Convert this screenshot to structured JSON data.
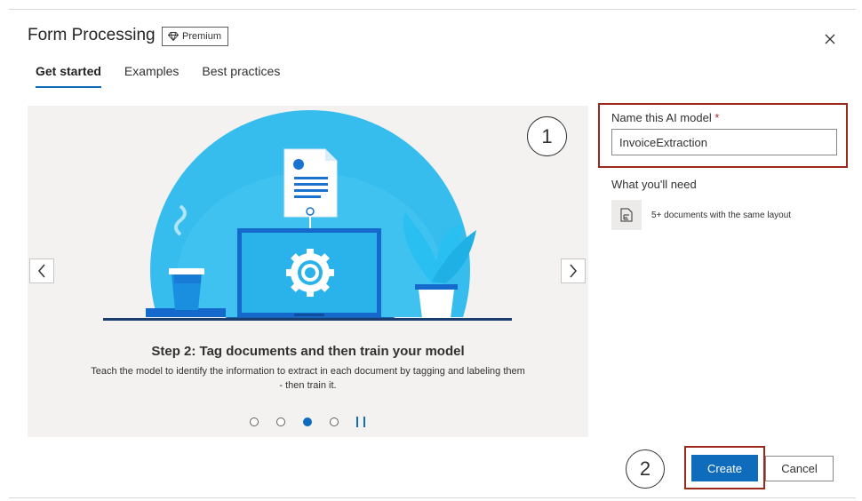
{
  "dialog": {
    "title": "Form Processing",
    "premium_badge": "Premium",
    "close_icon": "close-icon"
  },
  "tabs": [
    {
      "label": "Get started",
      "active": true
    },
    {
      "label": "Examples",
      "active": false
    },
    {
      "label": "Best practices",
      "active": false
    }
  ],
  "carousel": {
    "step_title": "Step 2: Tag documents and then train your model",
    "step_description": "Teach the model to identify the information to extract in each document by tagging and labeling them - then train it.",
    "current_slide": 3,
    "total_slides": 4,
    "prev_icon": "chevron-left-icon",
    "next_icon": "chevron-right-icon",
    "pause_icon": "pause-icon"
  },
  "model_name": {
    "label": "Name this AI model",
    "required_marker": "*",
    "value": "InvoiceExtraction"
  },
  "requirements": {
    "heading": "What you'll need",
    "items": [
      {
        "icon": "document-layout-icon",
        "text": "5+ documents with the same layout"
      }
    ]
  },
  "footer": {
    "create_label": "Create",
    "cancel_label": "Cancel"
  },
  "callouts": [
    "1",
    "2"
  ],
  "colors": {
    "accent": "#0f6cbd",
    "annotation_box": "#9b2a1d",
    "illustration_sky": "#33bff0"
  }
}
